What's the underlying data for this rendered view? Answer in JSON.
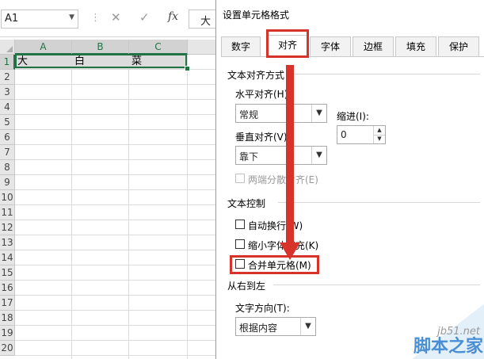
{
  "excel": {
    "namebox": "A1",
    "formula_value": "大",
    "fx_label": "fx",
    "cancel_glyph": "✕",
    "enter_glyph": "✓",
    "columns": [
      "A",
      "B",
      "C"
    ],
    "rows": [
      "1",
      "2",
      "3",
      "4",
      "5",
      "6",
      "7",
      "8",
      "9",
      "10",
      "11",
      "12",
      "13",
      "14",
      "15",
      "16",
      "17",
      "18",
      "19",
      "20"
    ],
    "cells": {
      "A1": "大",
      "B1": "白",
      "C1": "菜"
    }
  },
  "dialog": {
    "title": "设置单元格格式",
    "tabs": [
      "数字",
      "对齐",
      "字体",
      "边框",
      "填充",
      "保护"
    ],
    "active_tab": "对齐",
    "text_alignment": {
      "section": "文本对齐方式",
      "horizontal_label": "水平对齐(H):",
      "horizontal_value": "常规",
      "indent_label": "缩进(I):",
      "indent_value": "0",
      "vertical_label": "垂直对齐(V):",
      "vertical_value": "靠下",
      "distributed_label": "两端分散对齐(E)"
    },
    "text_control": {
      "section": "文本控制",
      "wrap_label": "自动换行(W)",
      "shrink_label": "缩小字体填充(K)",
      "merge_label": "合并单元格(M)"
    },
    "rtl": {
      "section": "从右到左",
      "direction_label": "文字方向(T):",
      "direction_value": "根据内容"
    }
  },
  "annotation": {
    "highlight_color": "#d8332a"
  },
  "watermark": {
    "site": "jb51.net",
    "brand": "脚本之家"
  }
}
